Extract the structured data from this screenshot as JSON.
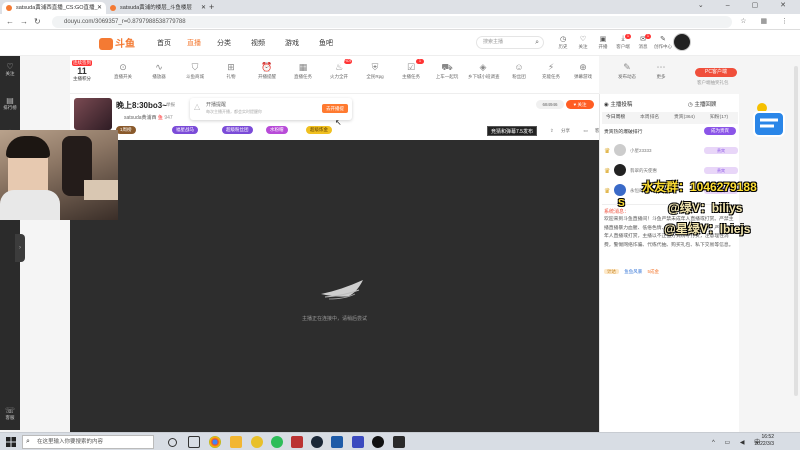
{
  "browser": {
    "tabs": [
      {
        "title": "satsuda黄浦西直播_CS:GO直播_"
      },
      {
        "title": "satsuda黄浦的楼层_斗鱼楼层"
      }
    ],
    "url": "douyu.com/3069357_r=0.8797988538779788"
  },
  "header": {
    "logo_text": "斗鱼",
    "nav": [
      "首页",
      "直播",
      "分类",
      "视频",
      "游戏",
      "鱼吧"
    ],
    "search_placeholder": "搜索主播",
    "icons": [
      {
        "label": "历史",
        "icon": "clock-icon"
      },
      {
        "label": "关注",
        "icon": "heart-icon"
      },
      {
        "label": "开播",
        "icon": "camera-icon"
      },
      {
        "label": "客户端",
        "icon": "download-icon",
        "badge": "1"
      },
      {
        "label": "消息",
        "icon": "mail-icon",
        "badge": "1"
      },
      {
        "label": "创作中心",
        "icon": "pen-icon"
      }
    ],
    "avatar_badge": "3"
  },
  "sidebar": [
    {
      "label": "关注",
      "icon": "heart-icon"
    },
    {
      "label": "排行榜",
      "icon": "chart-icon"
    },
    {
      "label": "足球",
      "icon": "ball-icon"
    },
    {
      "label": "客服",
      "icon": "support-icon"
    }
  ],
  "activities": {
    "level_top": "连续签到",
    "level_num": "11",
    "level_label": "主播积分",
    "items": [
      {
        "label": "直播开关",
        "icon": "toggle-icon"
      },
      {
        "label": "播放器",
        "icon": "wave-icon"
      },
      {
        "label": "斗鱼商城",
        "icon": "cart-icon"
      },
      {
        "label": "礼物",
        "icon": "gift-icon"
      },
      {
        "label": "开播提醒",
        "icon": "alarm-icon"
      },
      {
        "label": "直播任务",
        "icon": "calendar-icon"
      },
      {
        "label": "火力全开",
        "icon": "fire-icon",
        "hot": "HOT"
      },
      {
        "label": "全民Rpg",
        "icon": "shield-icon"
      },
      {
        "label": "主播任务",
        "icon": "check-icon",
        "hot": "1"
      },
      {
        "label": "上车一起玩",
        "icon": "car-icon"
      },
      {
        "label": "乡下城小班调查",
        "icon": "bag-icon"
      },
      {
        "label": "粉丝团",
        "icon": "people-icon"
      },
      {
        "label": "充能任务",
        "icon": "bolt-icon"
      },
      {
        "label": "弹幕游戏",
        "icon": "gamepad-icon"
      },
      {
        "label": "发布动态",
        "icon": "edit-icon"
      },
      {
        "label": "更多",
        "icon": "more-icon"
      }
    ],
    "pc_button": "PC客户端",
    "pc_sub": "客户端抽奖礼包"
  },
  "streamer": {
    "title": "晚上8:30bo3~",
    "tag": "举报",
    "name": "satsuda黄浦西",
    "badge": "鱼",
    "count": "947",
    "notice_title": "开播提醒",
    "notice_sub": "每次主播开播，都会实时提醒你",
    "notice_btn": "去开播提",
    "viewers": "684946",
    "follow": "关注",
    "pills": [
      {
        "label": "1周榜",
        "color": "#8a5a2c"
      },
      {
        "label": "福星战马",
        "color": "#7b4bd8"
      },
      {
        "label": "超级粉丝团",
        "color": "#7b4bd8"
      },
      {
        "label": "水粉帽",
        "color": "#b84bd8"
      },
      {
        "label": "超级炼金",
        "color": "#f0c020"
      }
    ],
    "guess": "竞猜和弹幕7.5发布",
    "tools": [
      "分享",
      "客户端观看"
    ]
  },
  "video": {
    "message": "主播正在连接中，请稍后尝试"
  },
  "right_panel": {
    "title": "主播投稿",
    "title2": "主播回顾",
    "tabs": [
      "今日周榜",
      "本周排名",
      "贵宾(364)",
      "知粉(17)"
    ],
    "subtitle": "贵宾热的爆破排行",
    "vip_button": "成为贵宾",
    "ranks": [
      {
        "name": "小星23333",
        "level": "贵宾"
      },
      {
        "name": "翡翠的天使惠",
        "level": "贵宾"
      },
      {
        "name": "永恒的",
        "level": "贵宾"
      }
    ],
    "system_label": "系统消息：",
    "system_msg": "欢迎来到斗鱼直播间！斗鱼严禁未成年人直播或打赏。严禁主播直播暴力血腥、低俗色情、赌博诈骗等违法信息。严禁未成年人直播或打赏，主播以不正当方式诱导打赏，注意理性消费，警惕网络诈骗、代练代抽、购买礼包、私下交易等信息。",
    "last_row": {
      "tag": "计达",
      "name": "鱼鱼风暴",
      "text": "5成金"
    }
  },
  "danmu": [
    "水友群：1046279188",
    "@绿V：biliys",
    "@星绿V：lbiejs",
    "S"
  ],
  "taskbar": {
    "search_placeholder": "在这里输入你要搜索的内容",
    "time": "16:52",
    "date": "2022/3/3"
  }
}
